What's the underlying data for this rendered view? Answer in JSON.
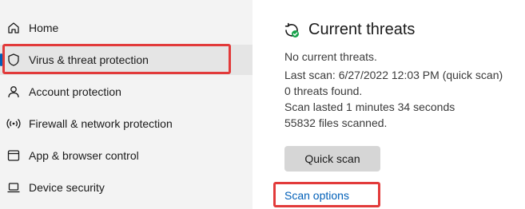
{
  "sidebar": {
    "items": [
      {
        "label": "Home",
        "icon": "home-icon"
      },
      {
        "label": "Virus & threat protection",
        "icon": "shield-icon",
        "selected": true
      },
      {
        "label": "Account protection",
        "icon": "person-icon"
      },
      {
        "label": "Firewall & network protection",
        "icon": "wifi-signal-icon"
      },
      {
        "label": "App & browser control",
        "icon": "app-window-icon"
      },
      {
        "label": "Device security",
        "icon": "laptop-icon"
      }
    ]
  },
  "main": {
    "title": "Current threats",
    "title_icon": "refresh-check-icon",
    "lines": [
      "No current threats.",
      "Last scan: 6/27/2022 12:03 PM (quick scan)",
      "0 threats found.",
      "Scan lasted 1 minutes 34 seconds",
      "55832 files scanned."
    ],
    "quick_scan_label": "Quick scan",
    "scan_options_label": "Scan options"
  },
  "colors": {
    "accent": "#005fb8",
    "highlight": "#e23a3a",
    "success": "#16a34a"
  }
}
